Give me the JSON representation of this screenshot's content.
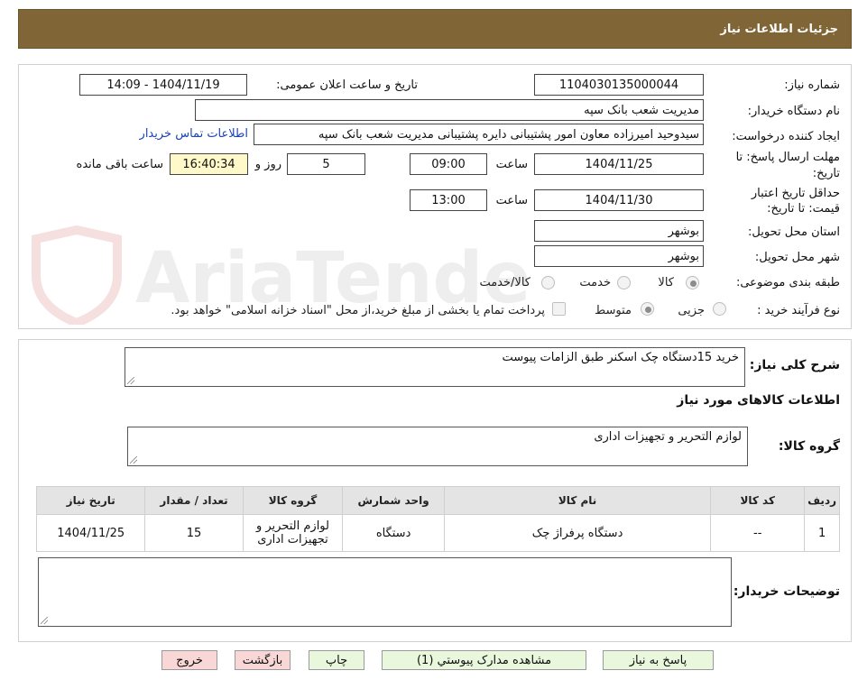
{
  "header": {
    "title": "جزئیات اطلاعات نیاز"
  },
  "watermark": {
    "text": "AriaTender.neT"
  },
  "form": {
    "need_number_label": "شماره نیاز:",
    "need_number": "1104030135000044",
    "announce_label": "تاریخ و ساعت اعلان عمومی:",
    "announce_value": "1404/11/19 - 14:09",
    "buyer_org_label": "نام دستگاه خریدار:",
    "buyer_org": "مدیریت شعب بانک سپه",
    "creator_label": "ایجاد کننده درخواست:",
    "creator": "سیدوحید امیرزاده معاون امور پشتیبانی دایره پشتیبانی مدیریت شعب بانک سپه",
    "contact_link": "اطلاعات تماس خریدار",
    "deadline_label_1": "مهلت ارسال پاسخ: تا",
    "deadline_label_2": "تاریخ:",
    "deadline_date": "1404/11/25",
    "time_label": "ساعت",
    "deadline_time": "09:00",
    "days_value": "5",
    "days_label": "روز و",
    "remaining_time": "16:40:34",
    "remaining_label": "ساعت باقی مانده",
    "validity_label_1": "حداقل تاریخ اعتبار",
    "validity_label_2": "قیمت: تا تاریخ:",
    "validity_date": "1404/11/30",
    "validity_time": "13:00",
    "province_label": "استان محل تحویل:",
    "province": "بوشهر",
    "city_label": "شهر محل تحویل:",
    "city": "بوشهر",
    "category_label": "طبقه بندی موضوعی:",
    "category_options": [
      "کالا",
      "خدمت",
      "کالا/خدمت"
    ],
    "process_label": "نوع فرآیند خرید :",
    "process_options": [
      "جزیی",
      "متوسط"
    ],
    "payment_note": "پرداخت تمام یا بخشی از مبلغ خرید،از محل \"اسناد خزانه اسلامی\" خواهد بود."
  },
  "details": {
    "summary_label": "شرح کلی نیاز:",
    "summary": "خرید 15دستگاه چک اسکنر طبق الزامات پیوست",
    "goods_info_title": "اطلاعات کالاهای مورد نیاز",
    "goods_group_label": "گروه کالا:",
    "goods_group": "لوازم التحریر و تجهیزات اداری"
  },
  "table": {
    "headers": [
      "ردیف",
      "کد کالا",
      "نام کالا",
      "واحد شمارش",
      "گروه کالا",
      "تعداد / مقدار",
      "تاریخ نیاز"
    ],
    "rows": [
      {
        "index": "1",
        "code": "--",
        "name": "دستگاه پرفراژ چک",
        "unit": "دستگاه",
        "group": "لوازم التحریر و تجهیزات اداری",
        "qty": "15",
        "date": "1404/11/25"
      }
    ]
  },
  "notes": {
    "label": "توضیحات خریدار:",
    "value": ""
  },
  "buttons": {
    "reply": "پاسخ به نیاز",
    "attachments": "مشاهده مدارک پیوستي (1)",
    "print": "چاپ",
    "back": "بازگشت",
    "exit": "خروج"
  }
}
